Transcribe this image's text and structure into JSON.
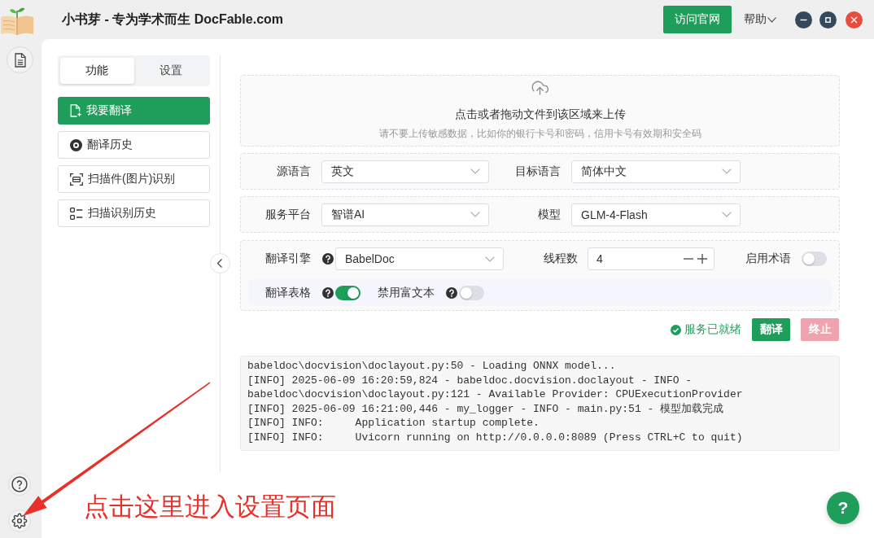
{
  "window": {
    "title": "小书芽 - 专为学术而生 DocFable.com",
    "visit_button": "访问官网",
    "help_menu": "帮助"
  },
  "tabs": [
    {
      "label": "功能",
      "selected": true
    },
    {
      "label": "设置",
      "selected": false
    }
  ],
  "nav": [
    {
      "label": "我要翻译",
      "kind": "file",
      "selected": true
    },
    {
      "label": "翻译历史",
      "kind": "disc",
      "selected": false
    },
    {
      "label": "扫描件(图片)识别",
      "kind": "scan",
      "selected": false
    },
    {
      "label": "扫描识别历史",
      "kind": "list",
      "selected": false
    }
  ],
  "upload": {
    "title": "点击或者拖动文件到该区域来上传",
    "hint": "请不要上传敏感数据，比如你的银行卡号和密码，信用卡号有效期和安全码"
  },
  "select_rows": [
    [
      {
        "label": "源语言",
        "value": "英文"
      },
      {
        "label": "目标语言",
        "value": "简体中文"
      }
    ],
    [
      {
        "label": "服务平台",
        "value": "智谱AI"
      },
      {
        "label": "模型",
        "value": "GLM-4-Flash"
      }
    ]
  ],
  "engine": {
    "label": "翻译引擎",
    "value": "BabelDoc",
    "threads_label": "线程数",
    "threads_value": "4",
    "glossary_label": "启用术语",
    "glossary_on": false
  },
  "options": [
    {
      "label": "翻译表格",
      "on": true
    },
    {
      "label": "禁用富文本",
      "on": false
    }
  ],
  "status": {
    "text": "服务已就绪",
    "ready": true
  },
  "actions": [
    {
      "label": "翻译",
      "kind": "primary",
      "disabled": false
    },
    {
      "label": "终止",
      "kind": "danger",
      "disabled": true
    }
  ],
  "log": [
    "babeldoc\\docvision\\doclayout.py:50 - Loading ONNX model...",
    "[INFO] 2025-06-09 16:20:59,824 - babeldoc.docvision.doclayout - INFO -",
    "babeldoc\\docvision\\doclayout.py:121 - Available Provider: CPUExecutionProvider",
    "[INFO] 2025-06-09 16:21:00,446 - my_logger - INFO - main.py:51 - 模型加载完成",
    "[INFO] INFO:     Application startup complete.",
    "[INFO] INFO:     Uvicorn running on http://0.0.0.0:8089 (Press CTRL+C to quit)"
  ],
  "help_button": "?",
  "annotation": "点击这里进入设置页面"
}
